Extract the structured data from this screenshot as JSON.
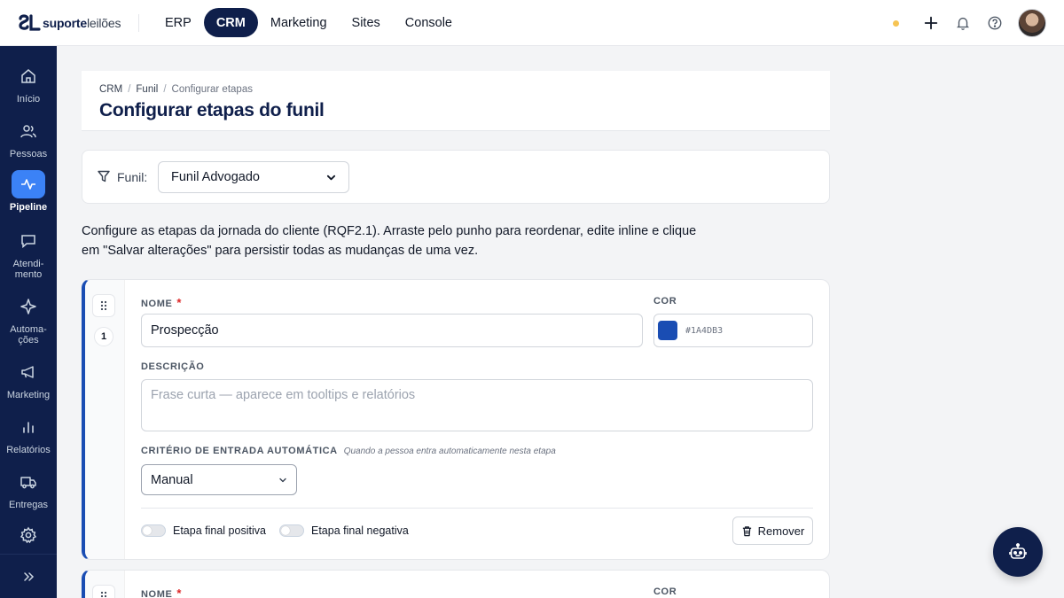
{
  "brand": {
    "bold": "suporte",
    "light": "leilões"
  },
  "topnav": [
    {
      "label": "ERP",
      "active": false
    },
    {
      "label": "CRM",
      "active": true
    },
    {
      "label": "Marketing",
      "active": false
    },
    {
      "label": "Sites",
      "active": false
    },
    {
      "label": "Console",
      "active": false
    }
  ],
  "topbar_icons": [
    "plus-icon",
    "bell-icon",
    "help-icon"
  ],
  "sidebar": {
    "items": [
      {
        "label": "Início",
        "icon": "home-icon"
      },
      {
        "label": "Pessoas",
        "icon": "users-icon"
      },
      {
        "label": "Pipeline",
        "icon": "pulse-icon",
        "active": true
      },
      {
        "label": "Atendi-\nmento",
        "icon": "chat-icon"
      },
      {
        "label": "Automa-\nções",
        "icon": "sparkle-icon"
      },
      {
        "label": "Marketing",
        "icon": "megaphone-icon"
      },
      {
        "label": "Relatórios",
        "icon": "bar-chart-icon"
      },
      {
        "label": "Entregas",
        "icon": "truck-icon"
      },
      {
        "label": "",
        "icon": "gear-icon"
      }
    ],
    "expand_icon": "chevrons-right-icon"
  },
  "breadcrumb": [
    "CRM",
    "Funil",
    "Configurar etapas"
  ],
  "page_title": "Configurar etapas do funil",
  "filter": {
    "label": "Funil:",
    "selected": "Funil Advogado"
  },
  "intro": "Configure as etapas da jornada do cliente (RQF2.1). Arraste pelo punho para reordenar, edite inline e clique em \"Salvar alterações\" para persistir todas as mudanças de uma vez.",
  "stage": {
    "order": "1",
    "name_label": "NOME",
    "required_mark": "*",
    "name_value": "Prospecção",
    "color_label": "COR",
    "color_value": "#1A4DB3",
    "description_label": "DESCRIÇÃO",
    "description_placeholder": "Frase curta — aparece em tooltips e relatórios",
    "criterion_label": "CRITÉRIO DE ENTRADA AUTOMÁTICA",
    "criterion_hint": "Quando a pessoa entra automaticamente nesta etapa",
    "criterion_value": "Manual",
    "toggle_positive": "Etapa final positiva",
    "toggle_negative": "Etapa final negativa",
    "remove_label": "Remover"
  },
  "stage2": {
    "name_label": "NOME",
    "required_mark": "*",
    "color_label": "COR"
  },
  "colors": {
    "navy": "#0f1f4b",
    "accent": "#3b82f6",
    "stage_color": "#1A4DB3",
    "status_dot": "#f6c453"
  },
  "fab_icon": "robot-icon"
}
